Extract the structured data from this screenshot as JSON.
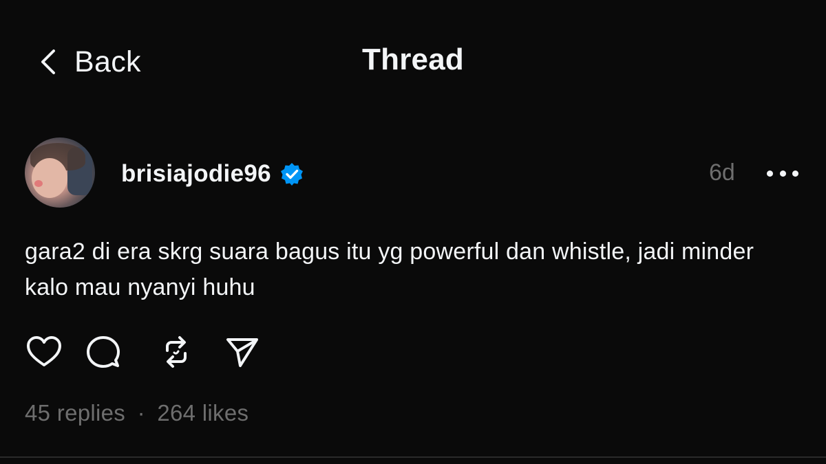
{
  "header": {
    "back_label": "Back",
    "title": "Thread"
  },
  "post": {
    "username": "brisiajodie96",
    "verified": true,
    "timestamp": "6d",
    "text": "gara2 di era skrg suara bagus itu yg powerful dan whistle, jadi minder kalo mau nyanyi huhu",
    "stats": {
      "replies": "45 replies",
      "separator": "·",
      "likes": "264 likes"
    }
  },
  "icons": {
    "back": "chevron-left-icon",
    "verified": "verified-badge-icon",
    "more": "more-horizontal-icon",
    "like": "heart-icon",
    "reply": "comment-icon",
    "repost": "repost-icon",
    "share": "send-icon"
  },
  "colors": {
    "background": "#0a0a0a",
    "text": "#f3f5f7",
    "muted": "#6e6e6e",
    "verified": "#0095f6"
  }
}
